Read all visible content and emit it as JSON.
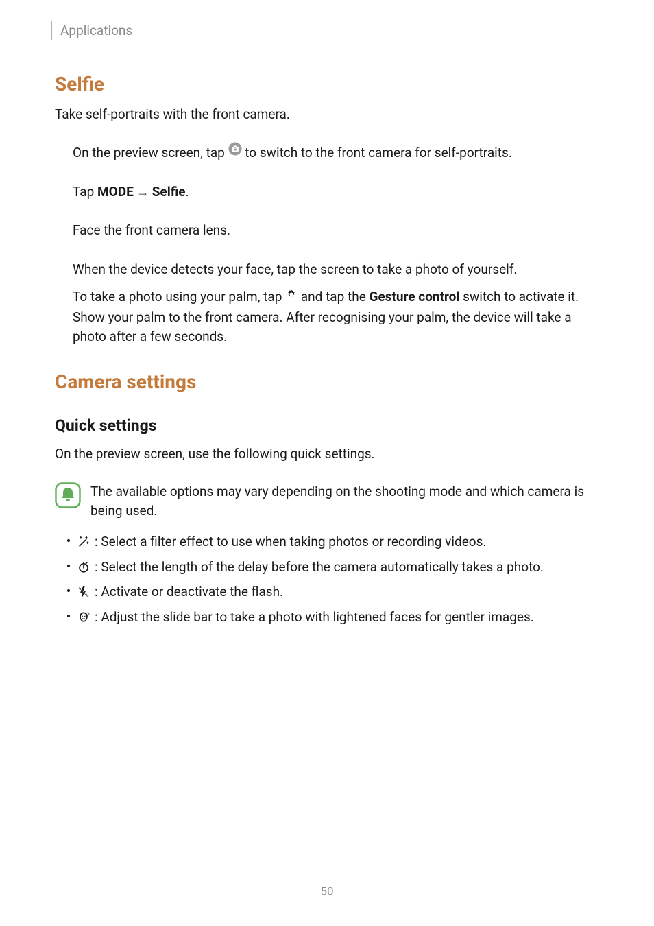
{
  "header": {
    "section": "Applications"
  },
  "selfie": {
    "heading": "Selfie",
    "intro": "Take self-portraits with the front camera.",
    "step1_a": "On the preview screen, tap ",
    "step1_b": " to switch to the front camera for self-portraits.",
    "step2_a": "Tap ",
    "step2_mode": "MODE",
    "step2_arrow": " → ",
    "step2_selfie": "Selfie",
    "step2_end": ".",
    "step3": "Face the front camera lens.",
    "step4": "When the device detects your face, tap the screen to take a photo of yourself.",
    "palm_a": "To take a photo using your palm, tap ",
    "palm_b": " and tap the ",
    "palm_bold": "Gesture control",
    "palm_c": " switch to activate it. Show your palm to the front camera. After recognising your palm, the device will take a photo after a few seconds."
  },
  "camera_settings": {
    "heading": "Camera settings",
    "quick_heading": "Quick settings",
    "intro": "On the preview screen, use the following quick settings.",
    "note": "The available options may vary depending on the shooting mode and which camera is being used.",
    "bullets": [
      {
        "text": ": Select a filter effect to use when taking photos or recording videos."
      },
      {
        "text": ": Select the length of the delay before the camera automatically takes a photo."
      },
      {
        "text": ": Activate or deactivate the flash."
      },
      {
        "text": ": Adjust the slide bar to take a photo with lightened faces for gentler images."
      }
    ]
  },
  "page_number": "50"
}
